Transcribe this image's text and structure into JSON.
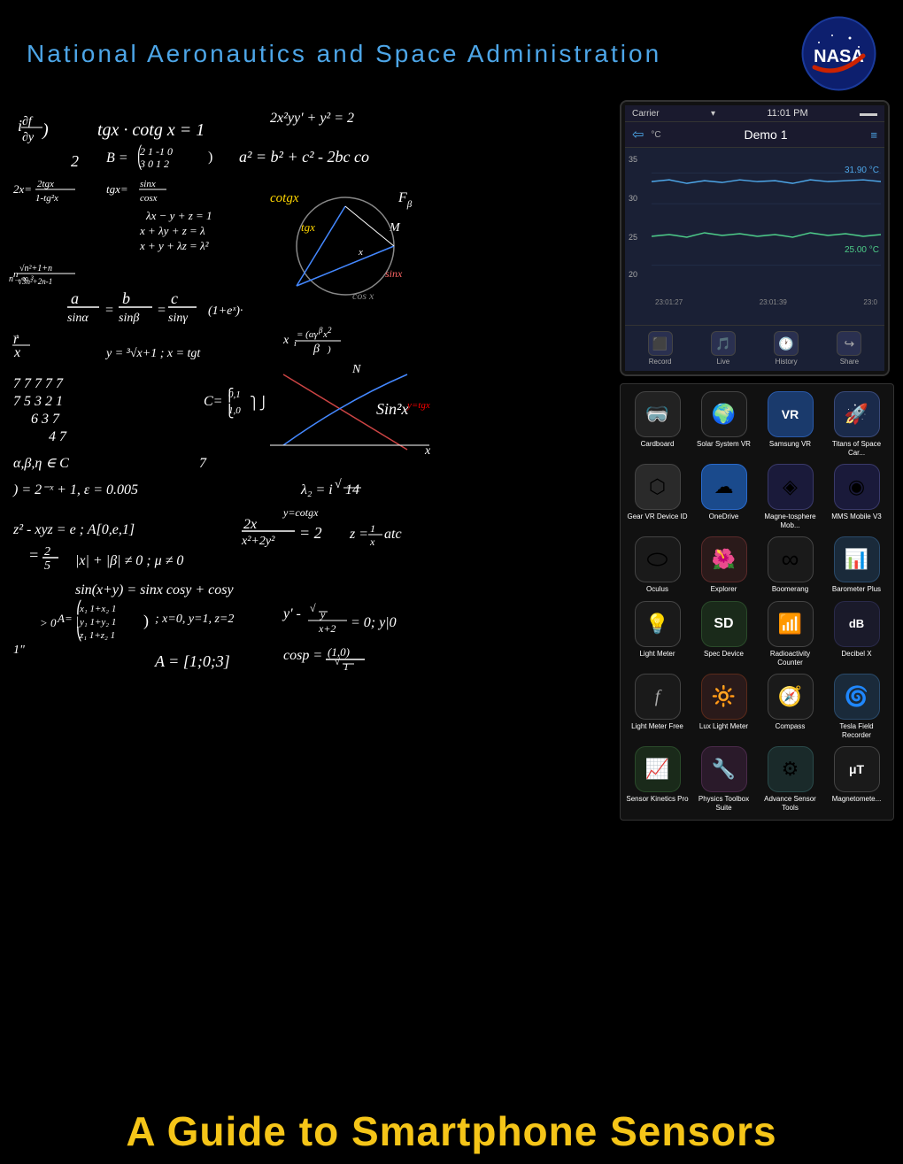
{
  "header": {
    "title": "National  Aeronautics  and  Space  Administration",
    "logo_text": "NASA"
  },
  "phone": {
    "carrier": "Carrier",
    "time": "11:01 PM",
    "demo": "Demo 1",
    "values": {
      "blue": "31.90 °C",
      "green": "25.00 °C"
    },
    "y_labels": [
      "35",
      "30",
      "25",
      "20"
    ],
    "time_labels": [
      "23:01:27",
      "23:01:39",
      "23:0"
    ],
    "bottom_icons": [
      "Record",
      "Live",
      "History",
      "Share"
    ]
  },
  "apps": [
    {
      "name": "Cardboard",
      "color": "#222",
      "icon": "🥽"
    },
    {
      "name": "Solar System VR",
      "color": "#1a1a1a",
      "icon": "🌍"
    },
    {
      "name": "Samsung VR",
      "color": "#1a3a6c",
      "icon": "VR"
    },
    {
      "name": "Titans of Space Car...",
      "color": "#1a2a4a",
      "icon": "🚀"
    },
    {
      "name": "Gear VR Device ID",
      "color": "#2a2a2a",
      "icon": "⬡"
    },
    {
      "name": "OneDrive",
      "color": "#1a4a8c",
      "icon": "☁"
    },
    {
      "name": "Magne-tosphere Mob...",
      "color": "#1a1a3a",
      "icon": "◈"
    },
    {
      "name": "MMS Mobile V3",
      "color": "#1a1a3a",
      "icon": "◉"
    },
    {
      "name": "Oculus",
      "color": "#1a1a1a",
      "icon": "⬭"
    },
    {
      "name": "Explorer",
      "color": "#2a1a1a",
      "icon": "🌺"
    },
    {
      "name": "Boomerang",
      "color": "#1a1a1a",
      "icon": "∞"
    },
    {
      "name": "Barometer Plus",
      "color": "#1a2a3a",
      "icon": "📊"
    },
    {
      "name": "Light Meter",
      "color": "#1a1a1a",
      "icon": "💡"
    },
    {
      "name": "Spec Device",
      "color": "#1a2a1a",
      "icon": "SD"
    },
    {
      "name": "Radioactivity Counter",
      "color": "#1a1a1a",
      "icon": "📶"
    },
    {
      "name": "Decibel X",
      "color": "#1a1a2a",
      "icon": "dB"
    },
    {
      "name": "Light Meter Free",
      "color": "#1a1a1a",
      "icon": "f"
    },
    {
      "name": "Lux Light Meter",
      "color": "#2a1a1a",
      "icon": "🔆"
    },
    {
      "name": "Compass",
      "color": "#1a1a1a",
      "icon": "🧭"
    },
    {
      "name": "Tesla Field Recorder",
      "color": "#1a2a3a",
      "icon": "🌀"
    },
    {
      "name": "Sensor Kinetics Pro",
      "color": "#1a2a1a",
      "icon": "📈"
    },
    {
      "name": "Physics Toolbox Suite",
      "color": "#2a1a2a",
      "icon": "🔧"
    },
    {
      "name": "Advance Sensor Tools",
      "color": "#1a2a2a",
      "icon": "⚙"
    },
    {
      "name": "Magnetomete...",
      "color": "#1a1a1a",
      "icon": "μT"
    }
  ],
  "bottom_title": "A Guide to Smartphone Sensors",
  "math_formulas": [
    "i ∂f/∂y )",
    "tgx · cotg x = 1",
    "2x²yy' + y² = 2",
    "B = (2 1 -1 0 / 3 0 1 2)",
    "a² = b² + c² - 2bc cos",
    "2x = 2tgx/(1-tg²x)",
    "tgx = sinx/cosx",
    "λx - y + z = 1",
    "x + λy + z = λ",
    "x + y + λz = λ²",
    "a/sinα = b/sinβ = c/sinγ",
    "(1+eˣ)·",
    "r→/x",
    "y = ³√(x+1) ; x = tgt",
    "7 7 7 7 7",
    "7 5 3 2 1",
    "6 3 7",
    "4 7",
    "C = {0,1 / 1,0}",
    "y = tgx",
    "sin²x",
    "α,β,η ∈ C",
    ") = 2⁻ˣ + 1, ε = 0.005",
    "λ₂ = i√14",
    "z² - xyz = e ; A[0,e,1]",
    "2x/(x²+2y²) = 2",
    "z = 1/x atc",
    "= 2/5",
    "|x| + |β| ≠ 0 ; μ ≠ 0",
    "sin(x+y) = sinx cosy + cosy",
    "A = (x₁ 1+x₂ 1 / y₁ 1+y₂ 1 / z₁ 1+z₂ 1)",
    "x=0, y=1, z=2",
    "y' - √y/(x+2) = 0; y|0",
    "A = [1;0;3]",
    "cosp = (1,0)/√1"
  ]
}
